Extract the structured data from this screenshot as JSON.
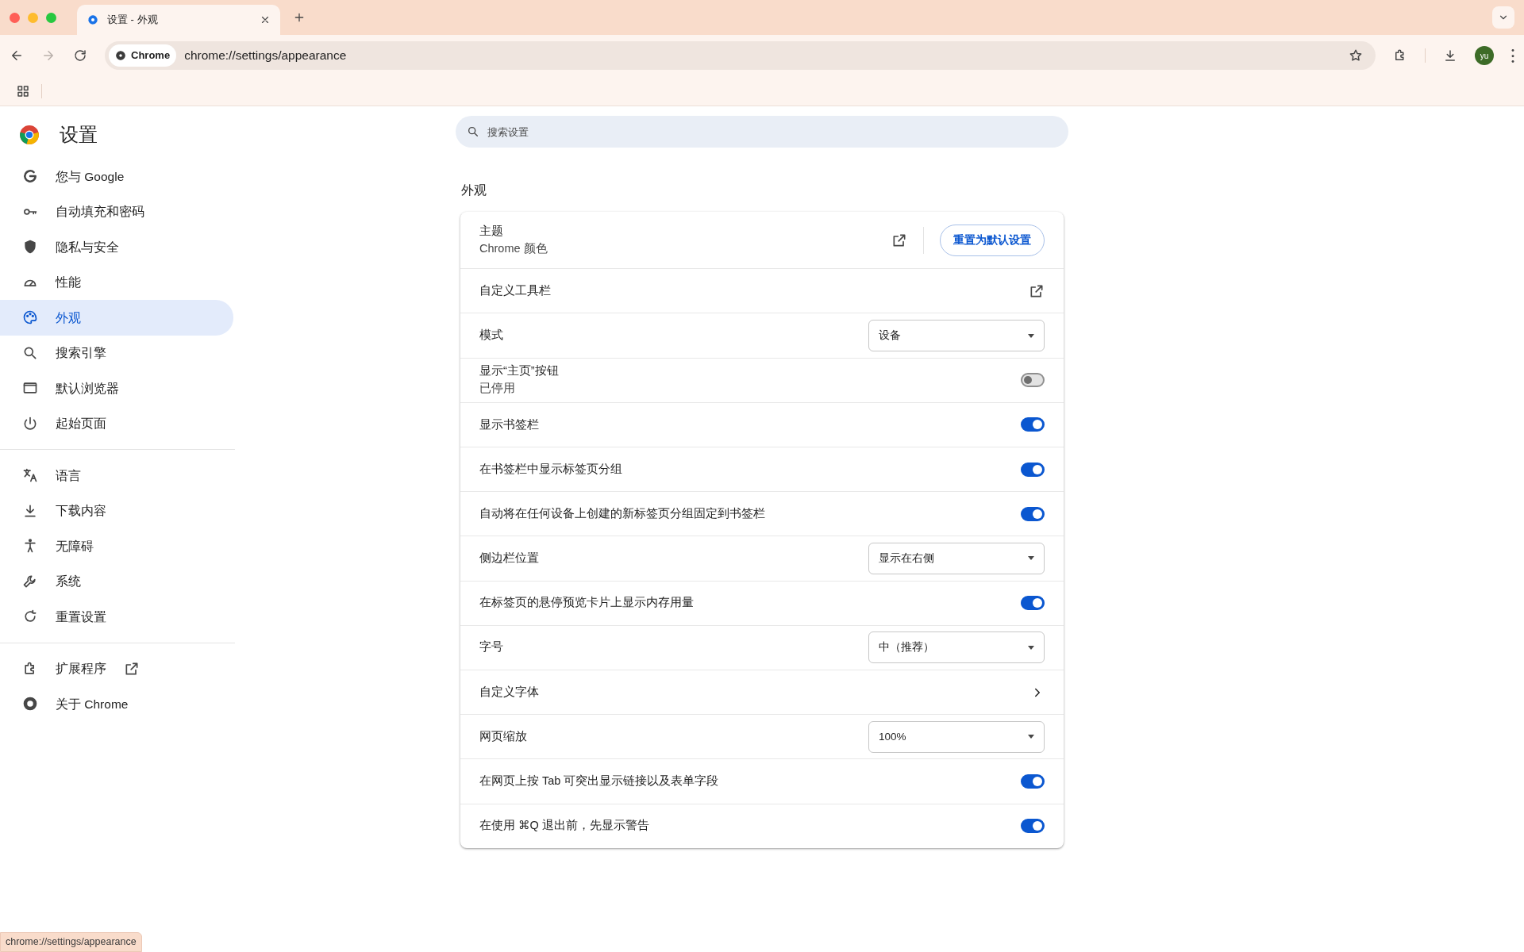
{
  "browser": {
    "tab": {
      "title": "设置 - 外观",
      "selected": true
    },
    "address": {
      "chip": "Chrome",
      "url": "chrome://settings/appearance"
    },
    "avatar": "yu"
  },
  "sidebar": {
    "title": "设置",
    "groups": [
      [
        {
          "label": "您与 Google",
          "selected": false,
          "kind": "page"
        },
        {
          "label": "自动填充和密码",
          "selected": false,
          "kind": "page"
        },
        {
          "label": "隐私与安全",
          "selected": false,
          "kind": "page"
        },
        {
          "label": "性能",
          "selected": false,
          "kind": "page"
        },
        {
          "label": "外观",
          "selected": true,
          "kind": "page"
        },
        {
          "label": "搜索引擎",
          "selected": false,
          "kind": "page"
        },
        {
          "label": "默认浏览器",
          "selected": false,
          "kind": "page"
        },
        {
          "label": "起始页面",
          "selected": false,
          "kind": "page"
        }
      ],
      [
        {
          "label": "语言",
          "selected": false,
          "kind": "page"
        },
        {
          "label": "下载内容",
          "selected": false,
          "kind": "page"
        },
        {
          "label": "无障碍",
          "selected": false,
          "kind": "page"
        },
        {
          "label": "系统",
          "selected": false,
          "kind": "page"
        },
        {
          "label": "重置设置",
          "selected": false,
          "kind": "page"
        }
      ],
      [
        {
          "label": "扩展程序",
          "selected": false,
          "kind": "external"
        },
        {
          "label": "关于 Chrome",
          "selected": false,
          "kind": "page"
        }
      ]
    ]
  },
  "search": {
    "placeholder": "搜索设置"
  },
  "section": {
    "title": "外观",
    "rows": [
      {
        "kind": "theme",
        "label": "主题",
        "sublabel": "Chrome 颜色",
        "button": "重置为默认设置"
      },
      {
        "kind": "link",
        "label": "自定义工具栏"
      },
      {
        "kind": "select",
        "label": "模式",
        "value": "设备"
      },
      {
        "kind": "toggle",
        "label": "显示“主页”按钮",
        "sublabel": "已停用",
        "on": false
      },
      {
        "kind": "toggle",
        "label": "显示书签栏",
        "on": true
      },
      {
        "kind": "toggle",
        "label": "在书签栏中显示标签页分组",
        "on": true
      },
      {
        "kind": "toggle",
        "label": "自动将在任何设备上创建的新标签页分组固定到书签栏",
        "on": true
      },
      {
        "kind": "select",
        "label": "侧边栏位置",
        "value": "显示在右侧"
      },
      {
        "kind": "toggle",
        "label": "在标签页的悬停预览卡片上显示内存用量",
        "on": true
      },
      {
        "kind": "select",
        "label": "字号",
        "value": "中（推荐）"
      },
      {
        "kind": "nav",
        "label": "自定义字体"
      },
      {
        "kind": "select",
        "label": "网页缩放",
        "value": "100%"
      },
      {
        "kind": "toggle",
        "label": "在网页上按 Tab 可突出显示链接以及表单字段",
        "on": true
      },
      {
        "kind": "toggle",
        "label": "在使用 ⌘Q 退出前，先显示警告",
        "on": true
      }
    ]
  },
  "status_bar": "chrome://settings/appearance"
}
